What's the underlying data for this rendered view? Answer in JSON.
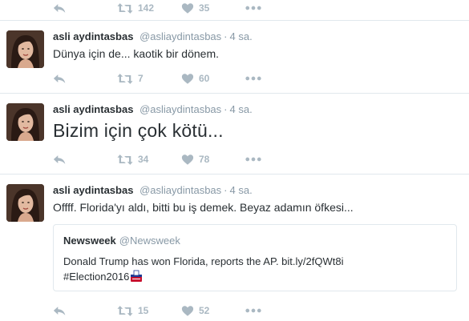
{
  "colors": {
    "muted": "#8899a6",
    "icon": "#aab8c2",
    "text": "#292f33",
    "border": "#e1e8ed"
  },
  "partial_tweet": {
    "retweets": "142",
    "likes": "35"
  },
  "tweets": [
    {
      "fullname": "asli aydintasbas",
      "handle": "@asliaydintasbas",
      "time": "4 sa.",
      "text": "Dünya için de... kaotik bir dönem.",
      "retweets": "7",
      "likes": "60"
    },
    {
      "fullname": "asli aydintasbas",
      "handle": "@asliaydintasbas",
      "time": "4 sa.",
      "text": "Bizim için çok kötü...",
      "retweets": "34",
      "likes": "78"
    },
    {
      "fullname": "asli aydintasbas",
      "handle": "@asliaydintasbas",
      "time": "4 sa.",
      "text": "Offff.  Florida'yı aldı, bitti bu iş demek. Beyaz adamın öfkesi...",
      "retweets": "15",
      "likes": "52",
      "quote": {
        "name": "Newsweek",
        "handle": "@Newsweek",
        "text_line1": "Donald Trump has won Florida, reports the AP. bit.ly/2fQWt8i",
        "text_line2": "#Election2016"
      }
    }
  ],
  "icons": {
    "reply": "reply-icon",
    "retweet": "retweet-icon",
    "like": "heart-icon",
    "more": "more-dots-icon",
    "flag": "ballot-box-icon"
  }
}
